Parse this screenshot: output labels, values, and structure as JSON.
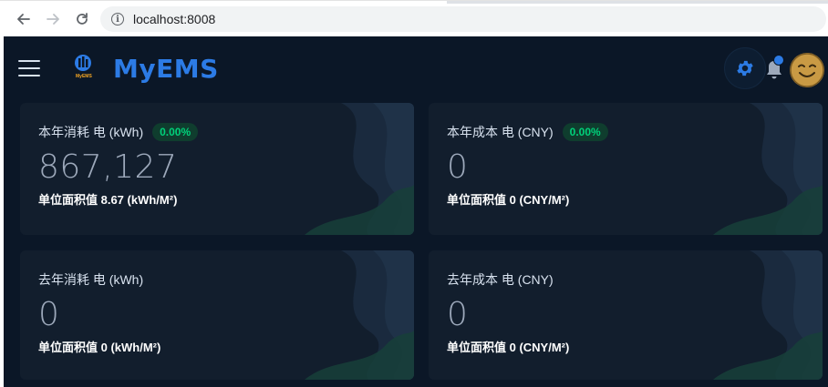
{
  "browser": {
    "url": "localhost:8008"
  },
  "app": {
    "brand": "MyEMS",
    "logo_caption": "MyEMS"
  },
  "colors": {
    "app_bg": "#0b1727",
    "card_bg": "#121e2d",
    "brand": "#2c7be5",
    "badge_text": "#00d27a",
    "badge_bg": "#0f3d2e",
    "value_text": "#9da9bb"
  },
  "icons": [
    "back-icon",
    "forward-icon",
    "reload-icon",
    "info-icon",
    "menu-icon",
    "myems-logo-icon",
    "gear-icon",
    "bell-icon",
    "avatar-icon"
  ],
  "cards": [
    {
      "title": "本年消耗 电 (kWh)",
      "badge": "0.00%",
      "value": "867,127",
      "subtitle": "单位面积值 8.67 (kWh/M²)"
    },
    {
      "title": "本年成本 电 (CNY)",
      "badge": "0.00%",
      "value": "0",
      "subtitle": "单位面积值 0 (CNY/M²)"
    },
    {
      "title": "去年消耗 电 (kWh)",
      "value": "0",
      "subtitle": "单位面积值 0 (kWh/M²)"
    },
    {
      "title": "去年成本 电 (CNY)",
      "value": "0",
      "subtitle": "单位面积值 0 (CNY/M²)"
    }
  ]
}
